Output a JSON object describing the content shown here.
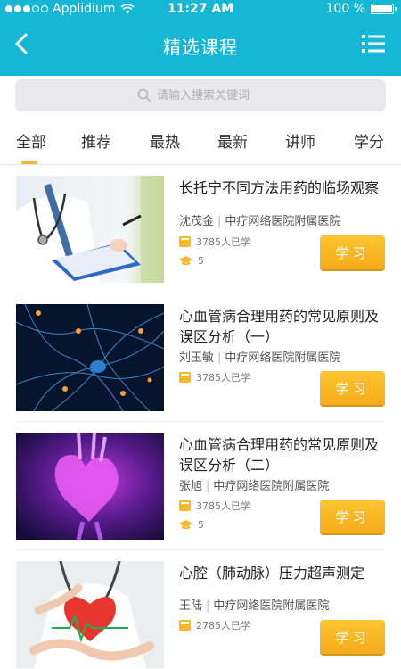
{
  "status": {
    "carrier": "Applidium",
    "time": "11:27 AM",
    "battery": "100 %"
  },
  "header": {
    "title": "精选课程"
  },
  "search": {
    "placeholder": "请输入搜索关键词"
  },
  "tabs": [
    {
      "label": "全部",
      "active": true
    },
    {
      "label": "推荐",
      "active": false
    },
    {
      "label": "最热",
      "active": false
    },
    {
      "label": "最新",
      "active": false
    },
    {
      "label": "讲师",
      "active": false
    },
    {
      "label": "学分",
      "active": false
    }
  ],
  "courses": [
    {
      "title": "长托宁不同方法用药的临场观察",
      "teacher": "沈茂金",
      "org": "中疗网络医院附属医院",
      "count": "3785人已学",
      "rank": "5",
      "button": "学习"
    },
    {
      "title": "心血管病合理用药的常见原则及误区分析（一）",
      "teacher": "刘玉敏",
      "org": "中疗网络医院附属医院",
      "count": "3785人已学",
      "rank": "",
      "button": "学习"
    },
    {
      "title": "心血管病合理用药的常见原则及误区分析（二）",
      "teacher": "张旭",
      "org": "中疗网络医院附属医院",
      "count": "3785人已学",
      "rank": "5",
      "button": "学习"
    },
    {
      "title": "心腔（肺动脉）压力超声测定",
      "teacher": "王陆",
      "org": "中疗网络医院附属医院",
      "count": "2785人已学",
      "rank": "",
      "button": "学习"
    }
  ],
  "colors": {
    "header": "#16b7d5",
    "accent": "#f6b82a",
    "search_bg": "#e9e9eb"
  }
}
